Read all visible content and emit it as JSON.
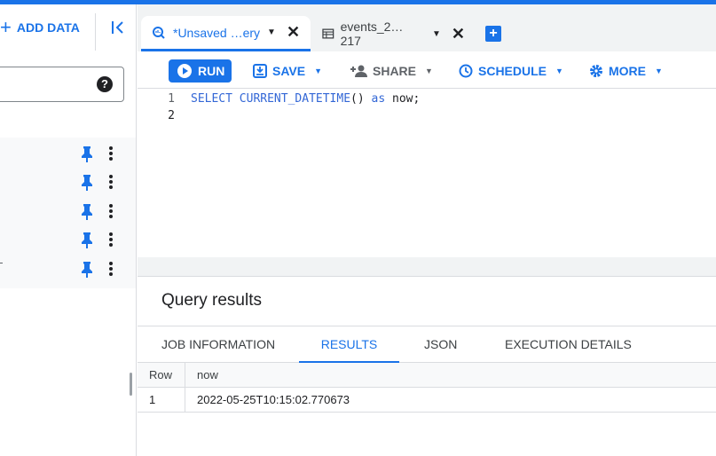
{
  "sidebar": {
    "add_data_label": "ADD DATA",
    "help_glyph": "?",
    "pinned_rows": 5
  },
  "tabs": [
    {
      "label": "*Unsaved …ery",
      "icon": "query-icon",
      "active": true
    },
    {
      "label": "events_2… 217",
      "icon": "table-icon",
      "active": false
    }
  ],
  "toolbar": {
    "run": "RUN",
    "save": "SAVE",
    "share": "SHARE",
    "schedule": "SCHEDULE",
    "more": "MORE"
  },
  "editor": {
    "line_numbers": [
      "1",
      "2"
    ],
    "tokens": {
      "select": "SELECT",
      "fn": "CURRENT_DATETIME",
      "parens": "()",
      "as": "as",
      "alias": "now;"
    }
  },
  "results": {
    "title": "Query results",
    "tabs": [
      "JOB INFORMATION",
      "RESULTS",
      "JSON",
      "EXECUTION DETAILS"
    ],
    "active_tab": "RESULTS",
    "columns": [
      "Row",
      "now"
    ],
    "rows": [
      [
        "1",
        "2022-05-25T10:15:02.770673"
      ]
    ]
  },
  "colors": {
    "accent": "#1a73e8"
  }
}
